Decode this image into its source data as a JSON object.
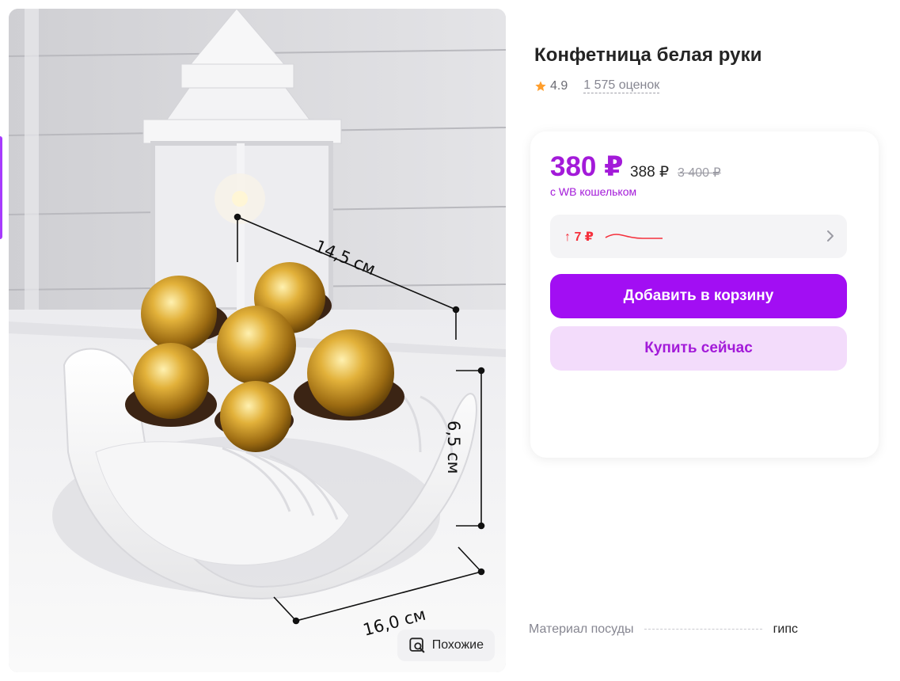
{
  "product": {
    "title": "Конфетница белая руки",
    "rating": "4.9",
    "reviews": "1 575 оценок"
  },
  "photo": {
    "labels": {
      "width": "14,5 см",
      "height": "6,5 см",
      "depth": "16,0 см"
    },
    "similar_label": "Похожие"
  },
  "pricing": {
    "price": "380 ₽",
    "regular_price": "388 ₽",
    "old_price": "3 400 ₽",
    "wallet_note": "с WB кошельком",
    "trend": "↑ 7 ₽"
  },
  "actions": {
    "add_to_cart": "Добавить в корзину",
    "buy_now": "Купить сейчас"
  },
  "specs": [
    {
      "key": "Материал посуды",
      "value": "гипс"
    }
  ],
  "colors": {
    "accent": "#a20ef3",
    "price": "#a31ad9",
    "trend_up": "#f5313d",
    "buy_bg": "#f3dcfb"
  }
}
